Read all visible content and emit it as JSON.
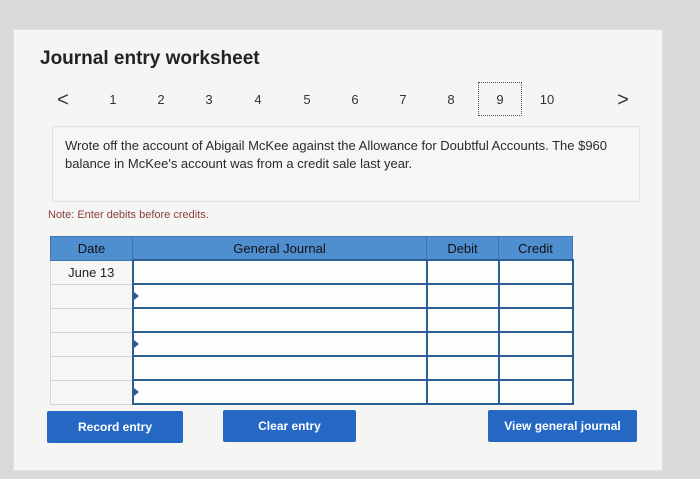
{
  "worksheet": {
    "title": "Journal entry worksheet"
  },
  "pager": {
    "prev": "<",
    "next": ">",
    "pages": [
      "1",
      "2",
      "3",
      "4",
      "5",
      "6",
      "7",
      "8",
      "9",
      "10"
    ],
    "current": "9"
  },
  "prompt": {
    "text": "Wrote off the account of Abigail McKee against the Allowance for Doubtful Accounts. The $960 balance in McKee's account was from a credit sale last year."
  },
  "note": "Note: Enter debits before credits.",
  "table": {
    "headers": {
      "date": "Date",
      "journal": "General Journal",
      "debit": "Debit",
      "credit": "Credit"
    },
    "rows": [
      {
        "date": "June 13"
      },
      {
        "date": ""
      },
      {
        "date": ""
      },
      {
        "date": ""
      },
      {
        "date": ""
      },
      {
        "date": ""
      }
    ]
  },
  "buttons": {
    "record": "Record entry",
    "clear": "Clear entry",
    "view": "View general journal"
  }
}
